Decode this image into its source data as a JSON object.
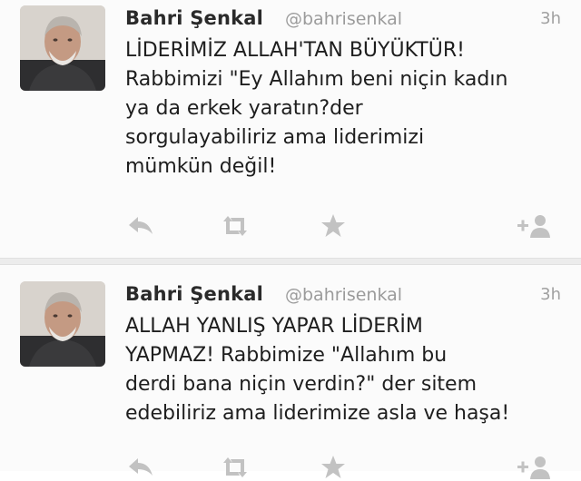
{
  "tweets": [
    {
      "author_name": "Bahri Şenkal",
      "handle": "@bahrisenkal",
      "time": "3h",
      "text_lines": [
        "LİDERİMİZ ALLAH'TAN BÜYÜKTÜR!",
        "Rabbimizi \"Ey Allahım beni niçin kadın",
        "ya da erkek yaratın?der",
        "sorgulayabiliriz ama liderimizi",
        "mümkün değil!"
      ],
      "actions": [
        "reply-icon",
        "retweet-icon",
        "favorite-icon",
        "follow-icon"
      ]
    },
    {
      "author_name": "Bahri Şenkal",
      "handle": "@bahrisenkal",
      "time": "3h",
      "text_lines": [
        "ALLAH YANLIŞ YAPAR LİDERİM",
        "YAPMAZ! Rabbimize \"Allahım bu",
        "derdi bana niçin verdin?\" der sitem",
        "edebiliriz ama liderimize asla ve haşa!"
      ],
      "actions": [
        "reply-icon",
        "retweet-icon",
        "favorite-icon",
        "follow-icon"
      ]
    }
  ],
  "colors": {
    "name": "#2a2a2a",
    "handle": "#9b9b9b",
    "text": "#1e1e1e",
    "icon": "#c2c2c2",
    "background": "#fbfbfb"
  }
}
